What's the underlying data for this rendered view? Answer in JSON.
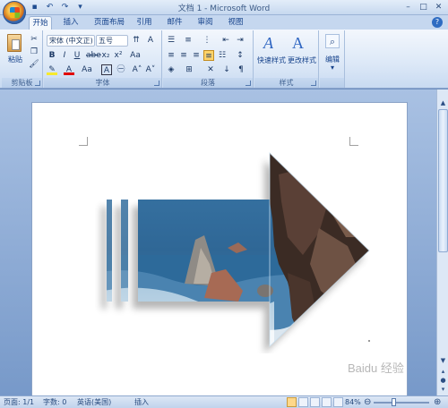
{
  "window": {
    "title": "文档 1 - Microsoft Word"
  },
  "tabs": [
    "开始",
    "插入",
    "页面布局",
    "引用",
    "邮件",
    "审阅",
    "视图"
  ],
  "ribbon": {
    "clipboard": {
      "paste_label": "粘贴",
      "group_label": "剪贴板"
    },
    "font": {
      "font_name": "宋体 (中文正)",
      "font_size": "五号",
      "group_label": "字体"
    },
    "paragraph": {
      "group_label": "段落"
    },
    "styles": {
      "quick_styles_label": "快速样式",
      "change_styles_label": "更改样式",
      "group_label": "样式"
    },
    "editing": {
      "edit_label": "编辑"
    }
  },
  "statusbar": {
    "page": "页面: 1/1",
    "words": "字数: 0",
    "language": "英语(美国)",
    "mode": "插入",
    "zoom": "84%"
  },
  "watermark": "Baidu 经验"
}
